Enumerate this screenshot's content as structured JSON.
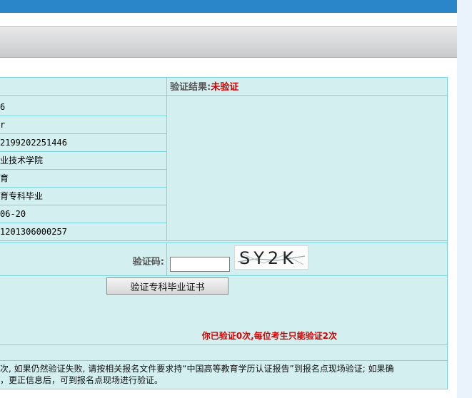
{
  "result": {
    "label": "验证结果:",
    "status": "未验证"
  },
  "info": {
    "rows": [
      "6",
      "r",
      "2199202251446",
      "业技术学院",
      "育",
      "育专科毕业",
      "06-20",
      "1201306000257"
    ]
  },
  "captcha": {
    "label": "验证码:",
    "value": "",
    "image_text": "SY2K"
  },
  "verify_button": "验证专科毕业证书",
  "warning": "你已验证0次,每位考生只能验证2次",
  "note": {
    "line1": "次, 如果仍然验证失败, 请按相关报名文件要求持“中国高等教育学历认证报告”到报名点现场验证; 如果确",
    "line2": "，更正信息后，可到报名点现场进行验证。"
  },
  "colors": {
    "top_bar": "#2a86c8",
    "panel_bg": "#d3efef",
    "border": "#7fd3db",
    "status_red": "#d40000"
  }
}
